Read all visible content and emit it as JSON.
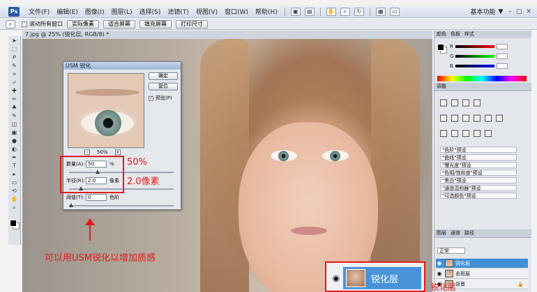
{
  "app": {
    "logo_text": "Ps"
  },
  "menubar": {
    "items": [
      "文件(F)",
      "编辑(E)",
      "图像(I)",
      "图层(L)",
      "选择(S)",
      "滤镜(T)",
      "视图(V)",
      "窗口(W)",
      "帮助(H)"
    ],
    "workspace_label": "基本功能",
    "workspace_arrow": "▼"
  },
  "optionsbar": {
    "scroll_all_label": "滚动所有窗口",
    "btn_actual_pixels": "实际像素",
    "btn_fit_screen": "适合屏幕",
    "btn_fill_screen": "填充屏幕",
    "btn_print_size": "打印尺寸"
  },
  "document": {
    "tab_title": "7.jpg @ 25% (锐化层, RGB/8) *"
  },
  "usm_dialog": {
    "title": "USM 锐化",
    "ok_label": "确定",
    "reset_label": "复位",
    "preview_label": "预览(P)",
    "zoom_percent": "50%",
    "amount_label": "数量(A):",
    "amount_value": "50",
    "amount_unit": "%",
    "radius_label": "半径(R):",
    "radius_value": "2.0",
    "radius_unit": "像素",
    "threshold_label": "阈值(T):",
    "threshold_value": "0",
    "threshold_unit": "色阶"
  },
  "annotations": {
    "amount_note": "50%",
    "radius_note": "2.0像素",
    "caption": "可以用USM锐化以增加质感",
    "callout_layer_name": "锐化层",
    "bottom_note": "锐化层"
  },
  "panels": {
    "color_tabs": [
      "颜色",
      "色板",
      "样式"
    ],
    "adjust_tab": "调整",
    "presets": [
      "\"色阶\"预设",
      "\"曲线\"预设",
      "\"曝光度\"预设",
      "\"色相/饱和度\"预设",
      "\"黑白\"预设",
      "\"通道混和器\"预设",
      "\"可选颜色\"预设"
    ],
    "layers_tabs": [
      "图层",
      "通道",
      "路径"
    ],
    "blend_mode": "正常",
    "layers": [
      {
        "name": "锐化层",
        "selected": true
      },
      {
        "name": "去斑层",
        "selected": false
      },
      {
        "name": "背景",
        "selected": false,
        "locked": true
      }
    ]
  },
  "colors": {
    "accent_red": "#e01b1b",
    "layer_selected": "#3f8fd7"
  }
}
